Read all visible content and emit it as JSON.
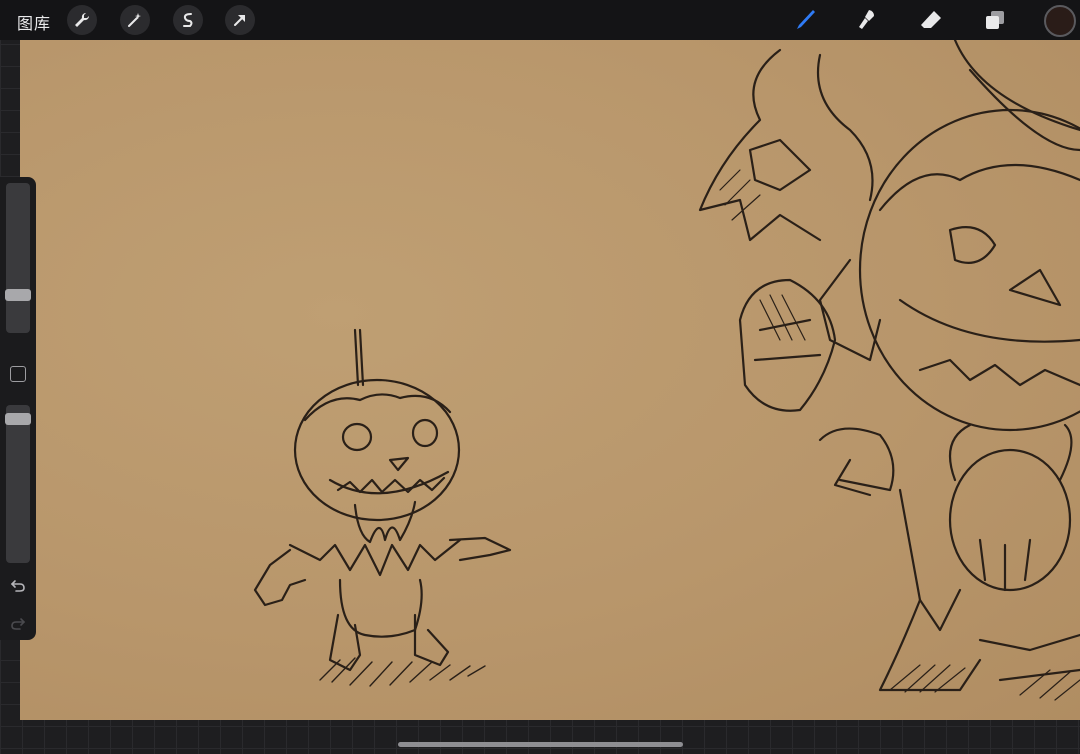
{
  "topbar": {
    "gallery_label": "图库",
    "actions": [
      "wrench-icon",
      "magic-wand-icon",
      "selection-icon",
      "move-arrow-icon"
    ],
    "tools": [
      "brush-icon",
      "smudge-icon",
      "eraser-icon",
      "layers-icon"
    ],
    "active_tool": "brush-icon",
    "active_tool_color": "#2f7bf5",
    "current_color": "#2a1c18"
  },
  "sidebar": {
    "brush_size_level": 0.27,
    "opacity_level": 0.95
  },
  "canvas": {
    "paper_color": "#b8966b",
    "ink_color": "#2a2018"
  }
}
